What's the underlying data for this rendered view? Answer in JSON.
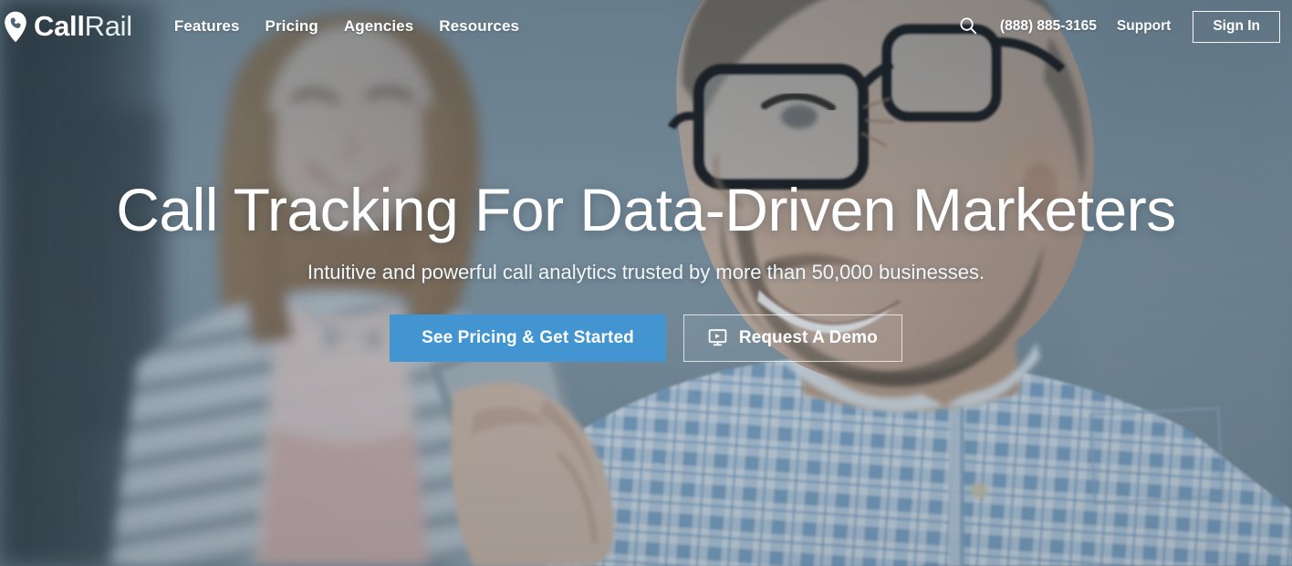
{
  "brand": {
    "name_bold": "Call",
    "name_light": "Rail",
    "logo_icon": "map-pin-phone-icon",
    "accent_color": "#4295d1"
  },
  "nav": {
    "links": [
      {
        "label": "Features"
      },
      {
        "label": "Pricing"
      },
      {
        "label": "Agencies"
      },
      {
        "label": "Resources"
      }
    ],
    "search_icon": "search-icon",
    "phone": "(888) 885-3165",
    "support_label": "Support",
    "signin_label": "Sign In"
  },
  "hero": {
    "title": "Call Tracking For Data-Driven Marketers",
    "subtitle": "Intuitive and powerful call analytics trusted by more than 50,000 businesses.",
    "cta_primary": "See Pricing & Get Started",
    "cta_secondary": "Request A Demo",
    "cta_secondary_icon": "monitor-presentation-icon",
    "background_description": "Blue-tinted photo of a smiling bearded man in glasses and a blue checked shirt holding a phone, with a blurred smiling woman in a striped cardigan behind him"
  }
}
